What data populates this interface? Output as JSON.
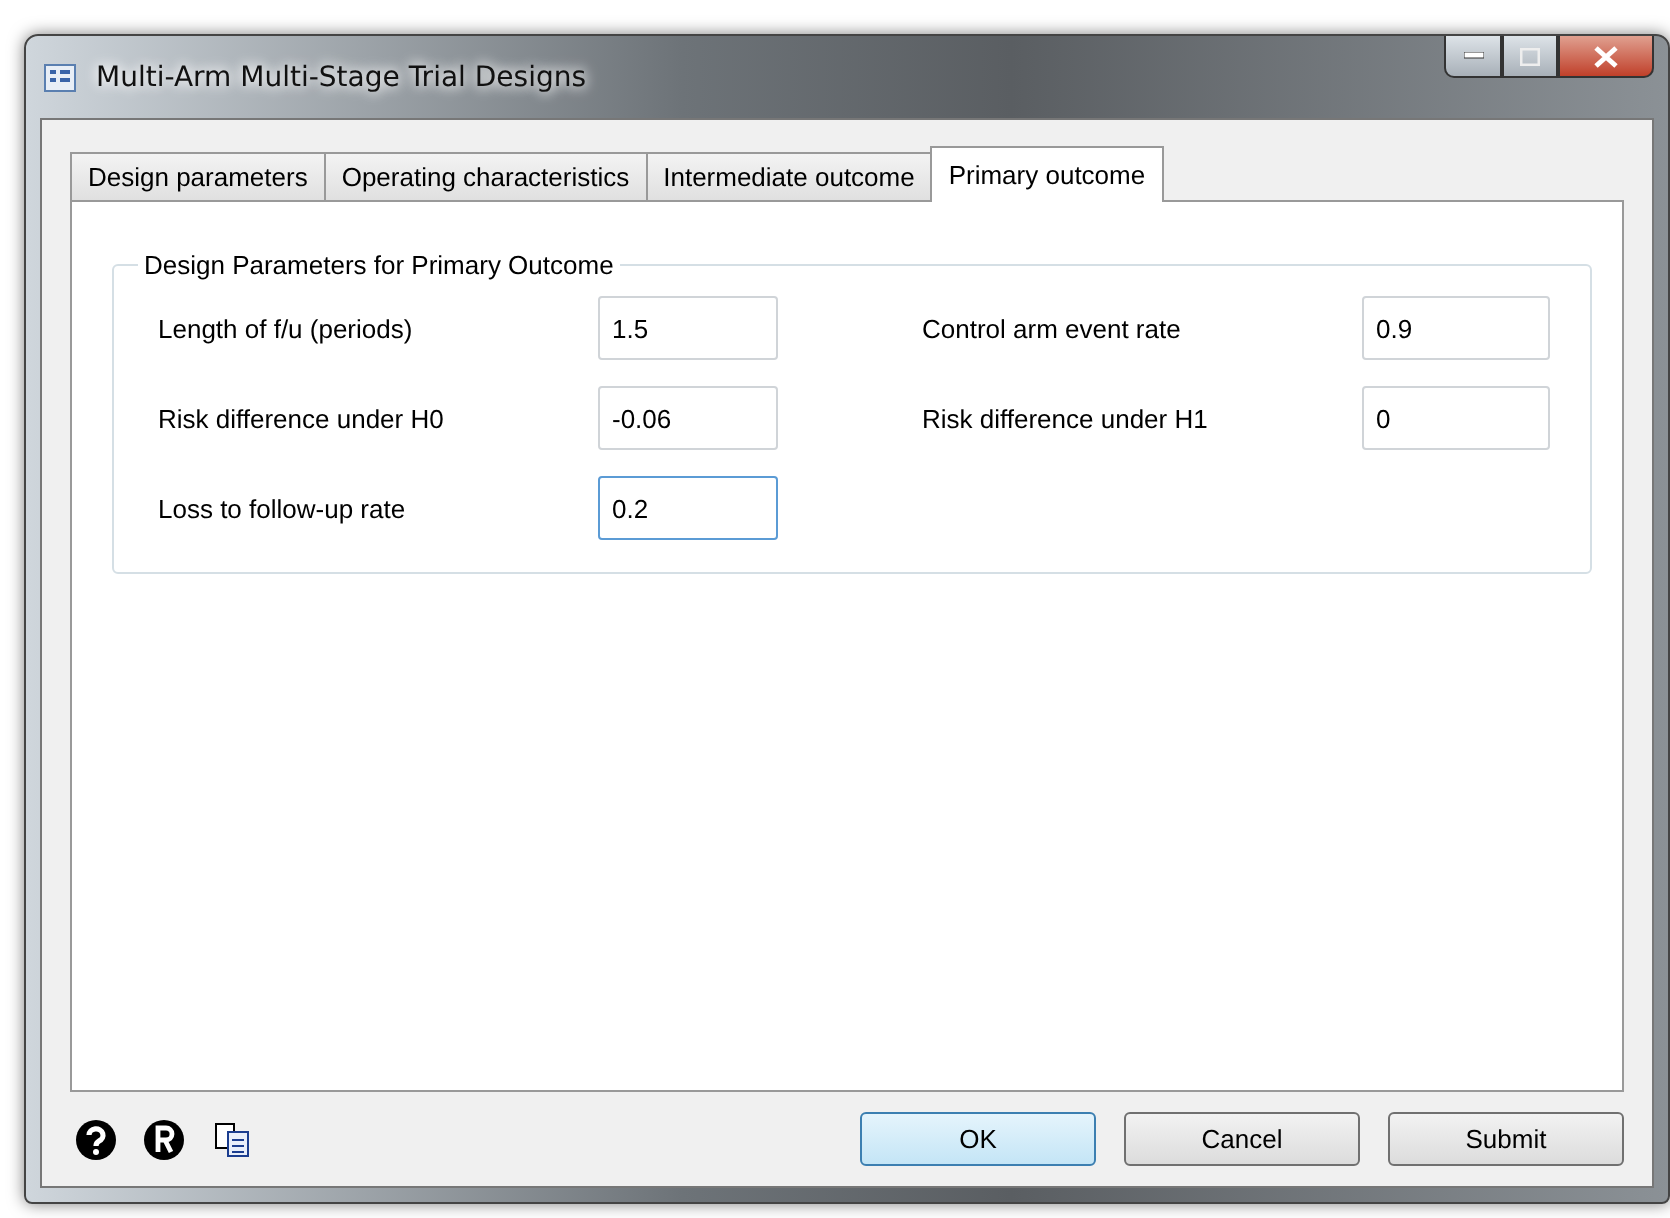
{
  "window": {
    "title": "Multi-Arm Multi-Stage Trial Designs"
  },
  "tabs": [
    {
      "label": "Design parameters",
      "selected": false
    },
    {
      "label": "Operating characteristics",
      "selected": false
    },
    {
      "label": "Intermediate outcome",
      "selected": false
    },
    {
      "label": "Primary outcome",
      "selected": true
    }
  ],
  "group": {
    "title": "Design Parameters for Primary Outcome",
    "fields": [
      {
        "label": "Length of f/u (periods)",
        "value": "1.5",
        "focused": false
      },
      {
        "label": "Control arm event rate",
        "value": "0.9",
        "focused": false
      },
      {
        "label": "Risk difference under H0",
        "value": "-0.06",
        "focused": false
      },
      {
        "label": "Risk difference under H1",
        "value": "0",
        "focused": false
      },
      {
        "label": "Loss to follow-up rate",
        "value": "0.2",
        "focused": true
      }
    ]
  },
  "buttons": [
    {
      "label": "OK",
      "default": true
    },
    {
      "label": "Cancel",
      "default": false
    },
    {
      "label": "Submit",
      "default": false
    }
  ]
}
